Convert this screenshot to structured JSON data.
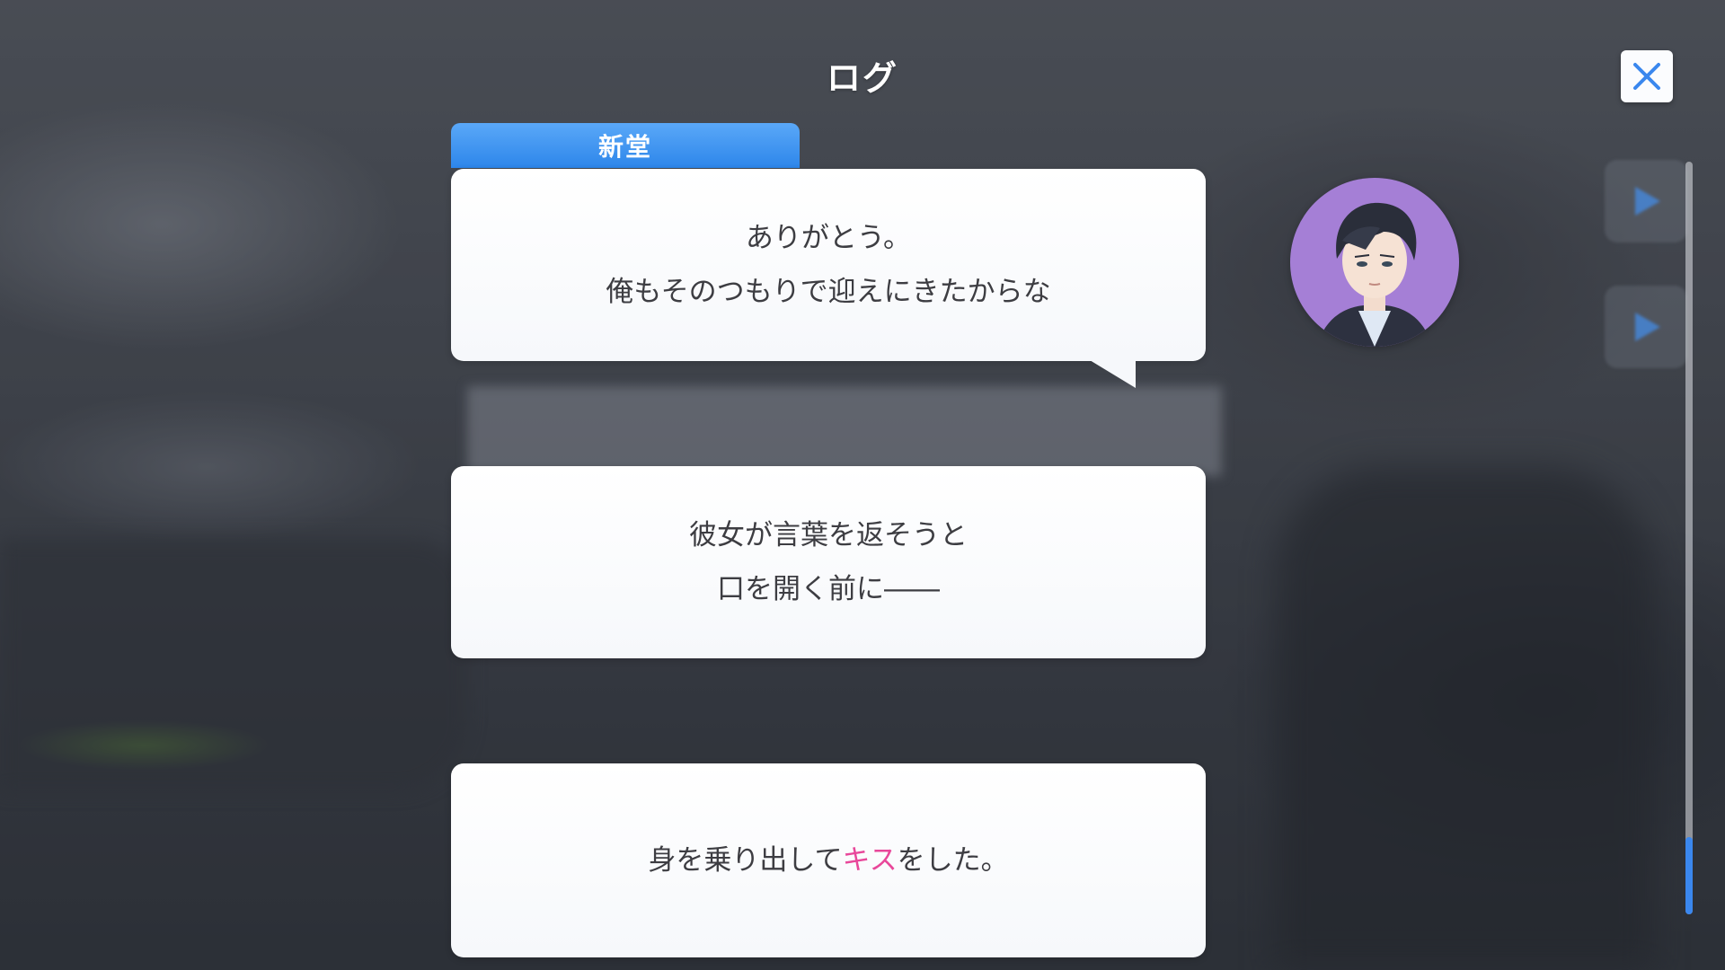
{
  "header": {
    "title": "ログ"
  },
  "close_button": {
    "icon": "close-icon",
    "accent": "#3a87ee"
  },
  "log_entries": [
    {
      "speaker": "新堂",
      "lines": [
        "ありがとう。",
        "俺もそのつもりで迎えにきたからな"
      ],
      "has_voice_replay": true
    },
    {
      "speaker": "",
      "lines": [
        "彼女が言葉を返そうと",
        "口を開く前に――"
      ]
    },
    {
      "speaker": "",
      "line_parts": [
        "身を乗り出して",
        "キス",
        "をした。"
      ],
      "highlight_color": "#e8479a"
    }
  ],
  "colors": {
    "speaker_tab": "#2d86ea",
    "avatar_background": "#a57fd6",
    "scrollbar_thumb": "#3a87ee"
  },
  "scroll": {
    "position": 1.0
  }
}
